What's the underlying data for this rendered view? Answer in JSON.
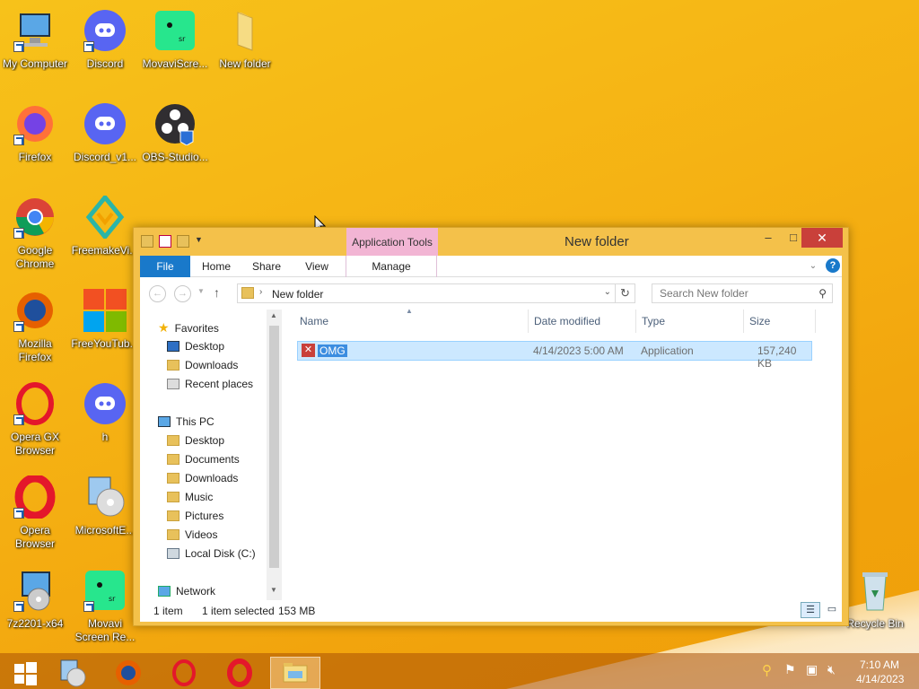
{
  "desktop": {
    "icons": [
      {
        "label": "My Computer"
      },
      {
        "label": "Discord"
      },
      {
        "label": "MovaviScre..."
      },
      {
        "label": "New folder"
      },
      {
        "label": "Firefox"
      },
      {
        "label": "Discord_v1..."
      },
      {
        "label": "OBS-Studio..."
      },
      {
        "label": "Google Chrome"
      },
      {
        "label": "FreemakeVi..."
      },
      {
        "label": "Mozilla Firefox"
      },
      {
        "label": "FreeYouTub..."
      },
      {
        "label": "Opera GX Browser"
      },
      {
        "label": "h"
      },
      {
        "label": "Opera Browser"
      },
      {
        "label": "MicrosoftE..."
      },
      {
        "label": "7z2201-x64"
      },
      {
        "label": "Movavi Screen Re..."
      },
      {
        "label": "Recycle Bin"
      }
    ]
  },
  "window": {
    "title": "New folder",
    "context_tab": "Application Tools",
    "minimize": "–",
    "maximize": "□",
    "close": "✕",
    "tabs": {
      "file": "File",
      "home": "Home",
      "share": "Share",
      "view": "View",
      "manage": "Manage"
    },
    "help": "?",
    "address": {
      "path": "New folder",
      "search_placeholder": "Search New folder"
    },
    "nav": {
      "favorites": "Favorites",
      "fav_items": [
        "Desktop",
        "Downloads",
        "Recent places"
      ],
      "this_pc": "This PC",
      "pc_items": [
        "Desktop",
        "Documents",
        "Downloads",
        "Music",
        "Pictures",
        "Videos",
        "Local Disk (C:)"
      ],
      "network": "Network"
    },
    "columns": {
      "name": "Name",
      "date": "Date modified",
      "type": "Type",
      "size": "Size"
    },
    "files": [
      {
        "name": "OMG",
        "date": "4/14/2023 5:00 AM",
        "type": "Application",
        "size": "157,240 KB"
      }
    ],
    "status": {
      "count": "1 item",
      "selected": "1 item selected",
      "size": "153 MB"
    }
  },
  "taskbar": {
    "time": "7:10 AM",
    "date": "4/14/2023"
  },
  "colors": {
    "accent": "#1979ca",
    "selection": "#cce8ff",
    "close": "#c9403a",
    "context_tab": "#f2b5d4"
  }
}
